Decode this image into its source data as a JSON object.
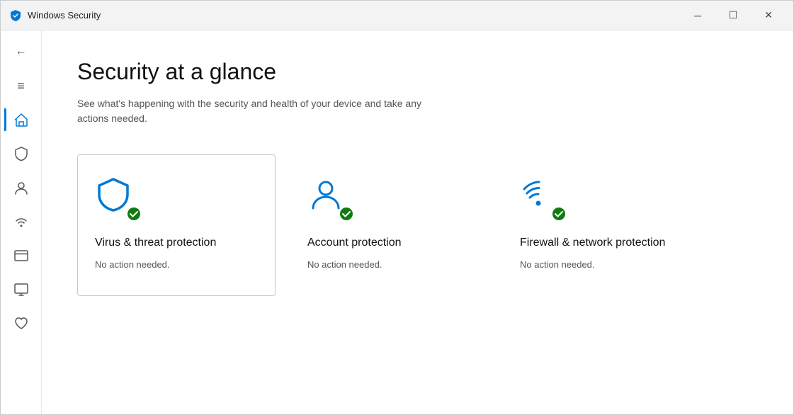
{
  "titleBar": {
    "title": "Windows Security",
    "minimizeLabel": "─",
    "maximizeLabel": "☐",
    "closeLabel": "✕"
  },
  "sidebar": {
    "backLabel": "←",
    "hamburgerLabel": "≡",
    "items": [
      {
        "id": "home",
        "icon": "home",
        "label": "Home",
        "active": true
      },
      {
        "id": "virus",
        "icon": "shield",
        "label": "Virus & threat protection",
        "active": false
      },
      {
        "id": "account",
        "icon": "person",
        "label": "Account protection",
        "active": false
      },
      {
        "id": "firewall",
        "icon": "wifi",
        "label": "Firewall & network protection",
        "active": false
      },
      {
        "id": "appbrowser",
        "icon": "window",
        "label": "App & browser control",
        "active": false
      },
      {
        "id": "device",
        "icon": "monitor",
        "label": "Device security",
        "active": false
      },
      {
        "id": "health",
        "icon": "heart",
        "label": "Device performance & health",
        "active": false
      }
    ]
  },
  "content": {
    "title": "Security at a glance",
    "subtitle": "See what's happening with the security and health of your device and take any actions needed.",
    "cards": [
      {
        "id": "virus-threat",
        "title": "Virus & threat protection",
        "status": "No action needed.",
        "iconType": "shield",
        "highlighted": true
      },
      {
        "id": "account-protection",
        "title": "Account protection",
        "status": "No action needed.",
        "iconType": "person",
        "highlighted": false
      },
      {
        "id": "firewall-network",
        "title": "Firewall & network protection",
        "status": "No action needed.",
        "iconType": "wifi",
        "highlighted": false
      }
    ]
  }
}
